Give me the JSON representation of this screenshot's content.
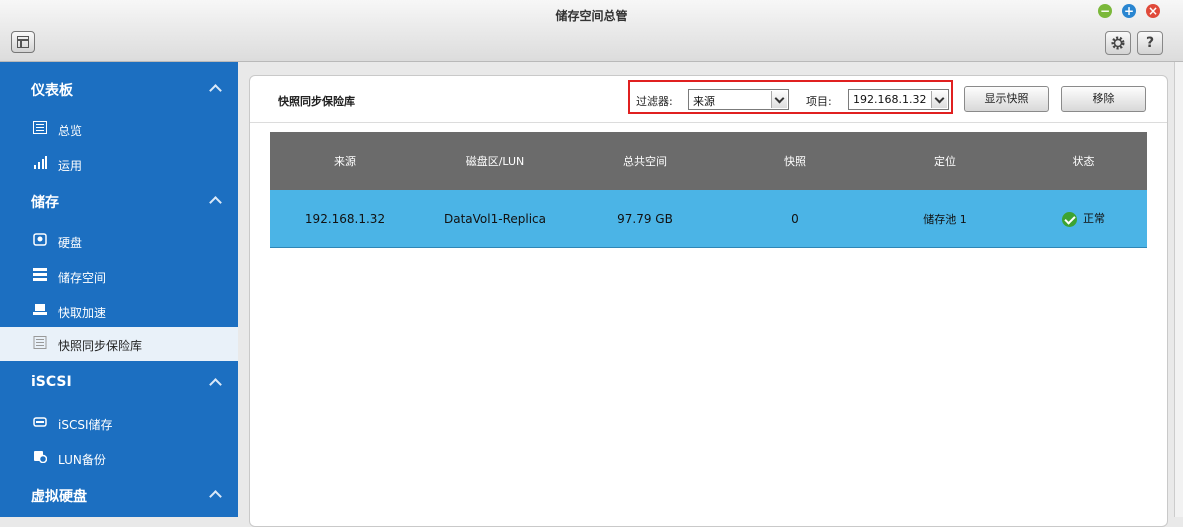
{
  "window": {
    "title": "储存空间总管",
    "help_label": "?"
  },
  "sidebar": {
    "sections": [
      {
        "label": "仪表板",
        "items": [
          {
            "label": "总览"
          },
          {
            "label": "运用"
          }
        ]
      },
      {
        "label": "储存",
        "items": [
          {
            "label": "硬盘"
          },
          {
            "label": "储存空间"
          },
          {
            "label": "快取加速"
          },
          {
            "label": "快照同步保险库"
          }
        ]
      },
      {
        "label": "iSCSI",
        "items": [
          {
            "label": "iSCSI储存"
          },
          {
            "label": "LUN备份"
          }
        ]
      },
      {
        "label": "虚拟硬盘",
        "items": []
      }
    ],
    "active_item": "快照同步保险库"
  },
  "main": {
    "title": "快照同步保险库",
    "filter": {
      "label": "过滤器:",
      "value": "来源"
    },
    "item": {
      "label": "项目:",
      "value": "192.168.1.32"
    },
    "show_snapshot_button": "显示快照",
    "remove_button": "移除",
    "table": {
      "columns": [
        "来源",
        "磁盘区/LUN",
        "总共空间",
        "快照",
        "定位",
        "状态"
      ],
      "rows": [
        {
          "source": "192.168.1.32",
          "volume": "DataVol1-Replica",
          "total": "97.79 GB",
          "snapshots": "0",
          "location": "储存池 1",
          "status": "正常"
        }
      ]
    }
  },
  "colors": {
    "sidebar": "#1c6fc1",
    "selected_row": "#4bb4e6",
    "header": "#6b6b6b",
    "highlight_border": "#e02020",
    "status_ok": "#3da332"
  }
}
